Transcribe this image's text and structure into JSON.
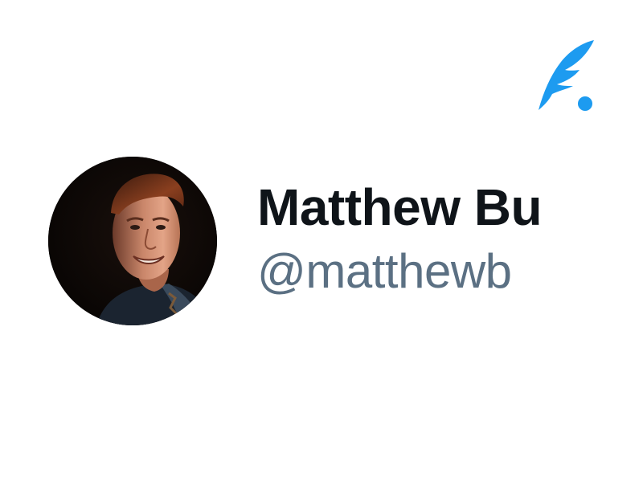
{
  "profile": {
    "display_name": "Matthew Bu",
    "handle": "@matthewb",
    "avatar": "avatar-photo"
  },
  "brand": {
    "icon": "feather-logo-icon",
    "accent_color": "#1d9bf0"
  },
  "colors": {
    "name_text": "#0f1419",
    "handle_text": "#5b7083",
    "background": "#ffffff"
  }
}
